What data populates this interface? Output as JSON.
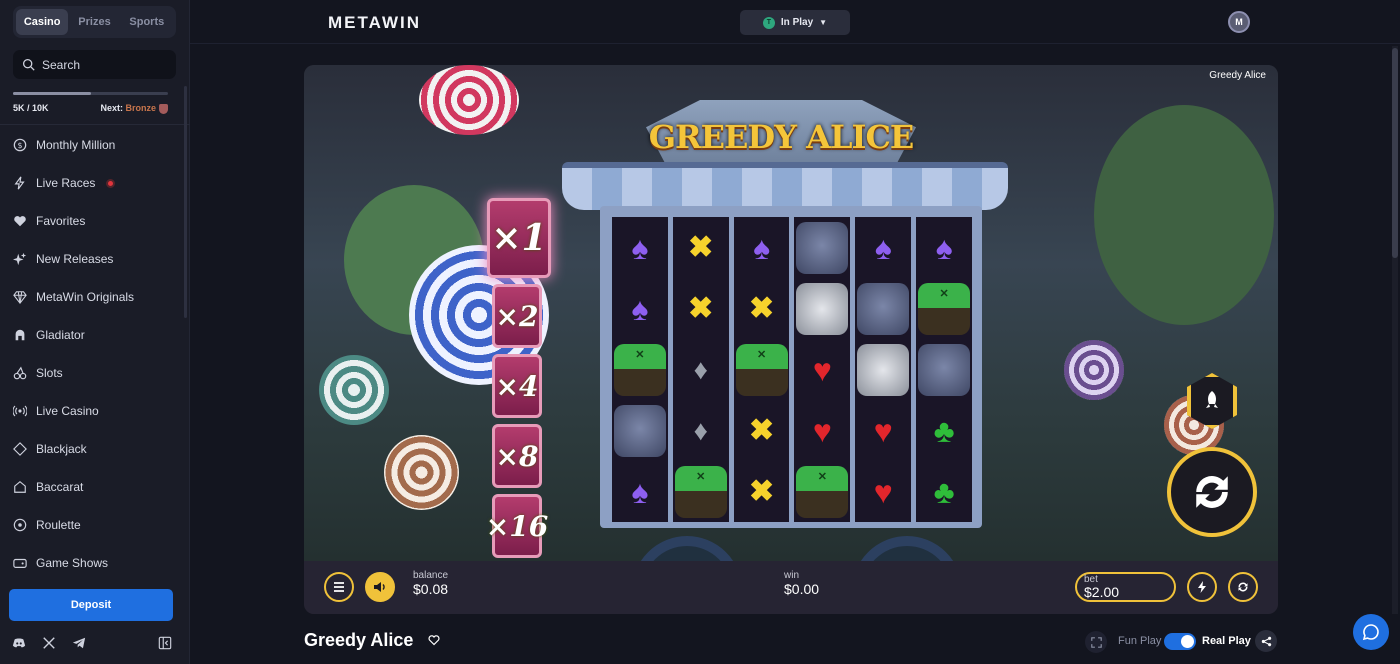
{
  "sidebar": {
    "tabs": [
      {
        "label": "Casino",
        "active": true
      },
      {
        "label": "Prizes",
        "active": false
      },
      {
        "label": "Sports",
        "active": false
      }
    ],
    "search_placeholder": "Search",
    "progress": {
      "current": "5K / 10K",
      "fraction": 0.5,
      "next_label": "Next:",
      "next_value": "Bronze"
    },
    "nav": [
      {
        "label": "Monthly Million",
        "icon": "dollar-circle-icon"
      },
      {
        "label": "Live Races",
        "icon": "lightning-icon",
        "live": true
      },
      {
        "label": "Favorites",
        "icon": "heart-icon"
      },
      {
        "label": "New Releases",
        "icon": "sparkle-icon"
      },
      {
        "label": "MetaWin Originals",
        "icon": "diamond-icon"
      },
      {
        "label": "Gladiator",
        "icon": "helmet-icon"
      },
      {
        "label": "Slots",
        "icon": "cherries-icon"
      },
      {
        "label": "Live Casino",
        "icon": "broadcast-icon"
      },
      {
        "label": "Blackjack",
        "icon": "cards-icon"
      },
      {
        "label": "Baccarat",
        "icon": "chip-icon"
      },
      {
        "label": "Roulette",
        "icon": "roulette-icon"
      },
      {
        "label": "Game Shows",
        "icon": "gamepad-icon"
      }
    ],
    "deposit_label": "Deposit"
  },
  "header": {
    "logo": "METAWIN",
    "inplay_label": "In Play",
    "avatar_initial": "M"
  },
  "game": {
    "provider_tag": "Greedy Alice",
    "cart_title": "GREEDY ALICE",
    "multipliers": [
      "×1",
      "×2",
      "×4",
      "×8",
      "×16"
    ],
    "reels": [
      [
        "spade",
        "spade",
        "hat",
        "cat",
        "spade"
      ],
      [
        "x",
        "x",
        "diamond",
        "diamond",
        "hat"
      ],
      [
        "spade",
        "x",
        "hat",
        "x",
        "x"
      ],
      [
        "cat",
        "knight",
        "heart",
        "heart",
        "hat"
      ],
      [
        "spade",
        "cat",
        "knight",
        "heart",
        "heart"
      ],
      [
        "spade",
        "hat",
        "cat",
        "club",
        "club"
      ]
    ],
    "controls": {
      "balance_label": "balance",
      "balance_value": "$0.08",
      "win_label": "win",
      "win_value": "$0.00",
      "bet_label": "bet",
      "bet_value": "$2.00"
    }
  },
  "below": {
    "title": "Greedy Alice",
    "fun_play": "Fun Play",
    "real_play": "Real Play"
  },
  "colors": {
    "accent_blue": "#1f6fe0",
    "gold": "#f0c23a",
    "live_red": "#e0353d"
  }
}
